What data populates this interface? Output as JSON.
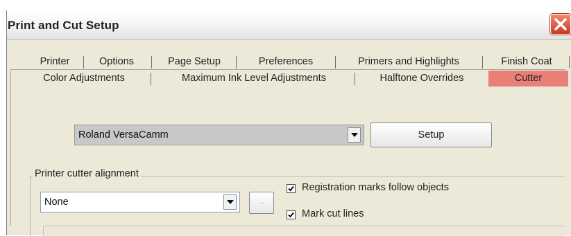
{
  "window": {
    "title": "Print and Cut Setup",
    "close_icon": "close-icon"
  },
  "tabs": {
    "row1": [
      "Printer",
      "Options",
      "Page Setup",
      "Preferences",
      "Primers and Highlights",
      "Finish Coat"
    ],
    "row2": [
      "Color Adjustments",
      "Maximum Ink Level Adjustments",
      "Halftone Overrides",
      "Cutter"
    ],
    "active": "Cutter",
    "active_color": "#e88078"
  },
  "cutter": {
    "device_value": "Roland VersaCamm",
    "setup_label": "Setup"
  },
  "alignment": {
    "group_label": "Printer cutter alignment",
    "value": "None",
    "browse_label": "...",
    "registration_label": "Registration marks follow objects",
    "registration_checked": true,
    "markcut_label": "Mark cut lines",
    "markcut_checked": true
  }
}
